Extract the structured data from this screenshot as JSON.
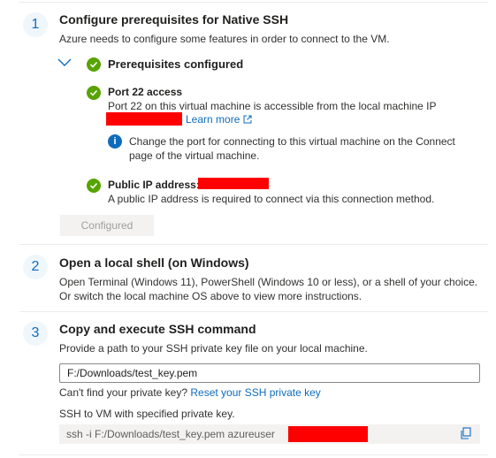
{
  "step1": {
    "number": "1",
    "title": "Configure prerequisites for Native SSH",
    "description": "Azure needs to configure some features in order to connect to the VM.",
    "prereq_header": "Prerequisites configured",
    "port": {
      "title": "Port 22 access",
      "description": "Port 22 on this virtual machine is accessible from the local machine IP",
      "learn_more": "Learn more",
      "info_line1": "Change the port for connecting to this virtual machine on the Connect",
      "info_line2": "page of the virtual machine."
    },
    "public_ip": {
      "title": "Public IP address:",
      "description": "A public IP address is required to connect via this connection method."
    },
    "configured_button": "Configured"
  },
  "step2": {
    "number": "2",
    "title": "Open a local shell (on Windows)",
    "line1": "Open Terminal (Windows 11), PowerShell (Windows 10 or less), or a shell of your choice.",
    "line2": "Or switch the local machine OS above to view more instructions."
  },
  "step3": {
    "number": "3",
    "title": "Copy and execute SSH command",
    "description": "Provide a path to your SSH private key file on your local machine.",
    "key_path_value": "F:/Downloads/test_key.pem",
    "cant_find": "Can't find your private key?",
    "reset_link": "Reset your SSH private key",
    "ssh_label": "SSH to VM with specified private key.",
    "command": "ssh -i F:/Downloads/test_key.pem azureuser"
  },
  "colors": {
    "accent": "#0f6cbd",
    "success": "#57a300",
    "redaction": "#ff0000"
  }
}
